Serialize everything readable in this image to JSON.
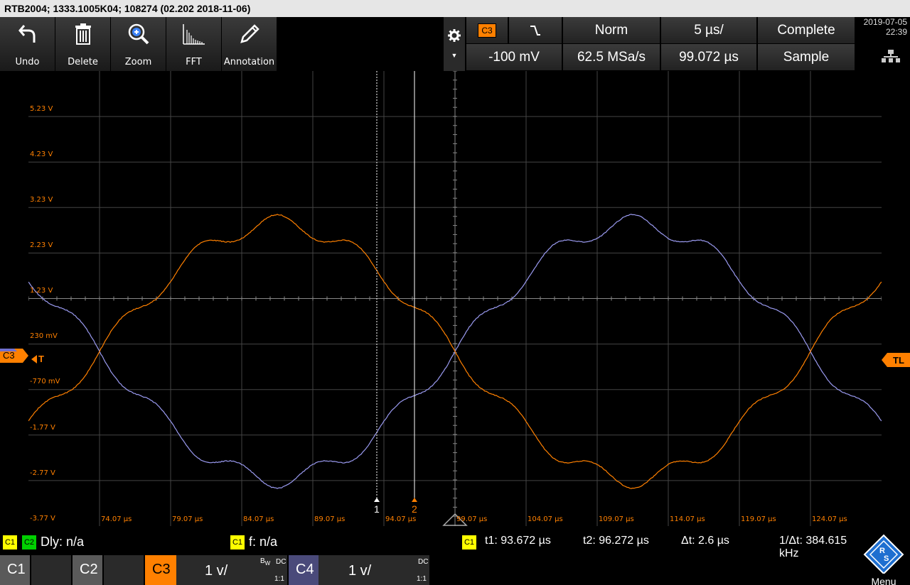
{
  "title": "RTB2004; 1333.1005K04; 108274 (02.202 2018-11-06)",
  "toolbar": [
    {
      "label": "Undo",
      "icon": "undo-icon"
    },
    {
      "label": "Delete",
      "icon": "trash-icon"
    },
    {
      "label": "Zoom",
      "icon": "zoom-icon"
    },
    {
      "label": "FFT",
      "icon": "fft-icon"
    },
    {
      "label": "Annotation",
      "icon": "pencil-icon"
    }
  ],
  "trigger": {
    "source": "C3",
    "slope": "falling",
    "mode": "Norm",
    "level": "-100 mV"
  },
  "timebase": {
    "scale": "5 µs/",
    "sample_rate": "62.5 MSa/s",
    "position": "99.072 µs"
  },
  "acquisition": {
    "status": "Complete",
    "mode": "Sample"
  },
  "datetime": {
    "date": "2019-07-05",
    "time": "22:39"
  },
  "levels": [
    "5.23 V",
    "4.23 V",
    "3.23 V",
    "2.23 V",
    "1.23 V",
    "230 mV",
    "-770 mV",
    "-1.77 V",
    "-2.77 V",
    "-3.77 V"
  ],
  "time_labels": [
    "74.07 µs",
    "79.07 µs",
    "84.07 µs",
    "89.07 µs",
    "94.07 µs",
    "99.07 µs",
    "104.07 µs",
    "109.07 µs",
    "114.07 µs",
    "119.07 µs",
    "124.07 µs"
  ],
  "cursors": {
    "c1_label": "1",
    "c2_label": "2"
  },
  "markers": {
    "c3": "C3",
    "c4": "C4",
    "trigger": "T",
    "trigger_level": "TL"
  },
  "info": {
    "c1": "C1",
    "c2": "C2",
    "dly": "Dly: n/a",
    "f_chip": "C1",
    "f": "f: n/a",
    "meas_chip": "C1",
    "t1": "t1: 93.672 µs",
    "t2": "t2: 96.272 µs",
    "dt": "Δt: 2.6 µs",
    "inv_dt": "1/Δt: 384.615 kHz"
  },
  "channels": [
    {
      "name": "C1",
      "scale": "",
      "coupling": "",
      "ratio": ""
    },
    {
      "name": "C2",
      "scale": "",
      "coupling": "",
      "ratio": ""
    },
    {
      "name": "C3",
      "scale": "1 v/",
      "bw": "B",
      "bw_sub": "W",
      "coupling": "DC",
      "ratio": "1:1"
    },
    {
      "name": "C4",
      "scale": "1 v/",
      "coupling": "DC",
      "ratio": "1:1"
    }
  ],
  "menu_label": "Menu",
  "colors": {
    "c3": "#ff8000",
    "c4": "#9a9af0",
    "grid": "#5a5a5a"
  }
}
